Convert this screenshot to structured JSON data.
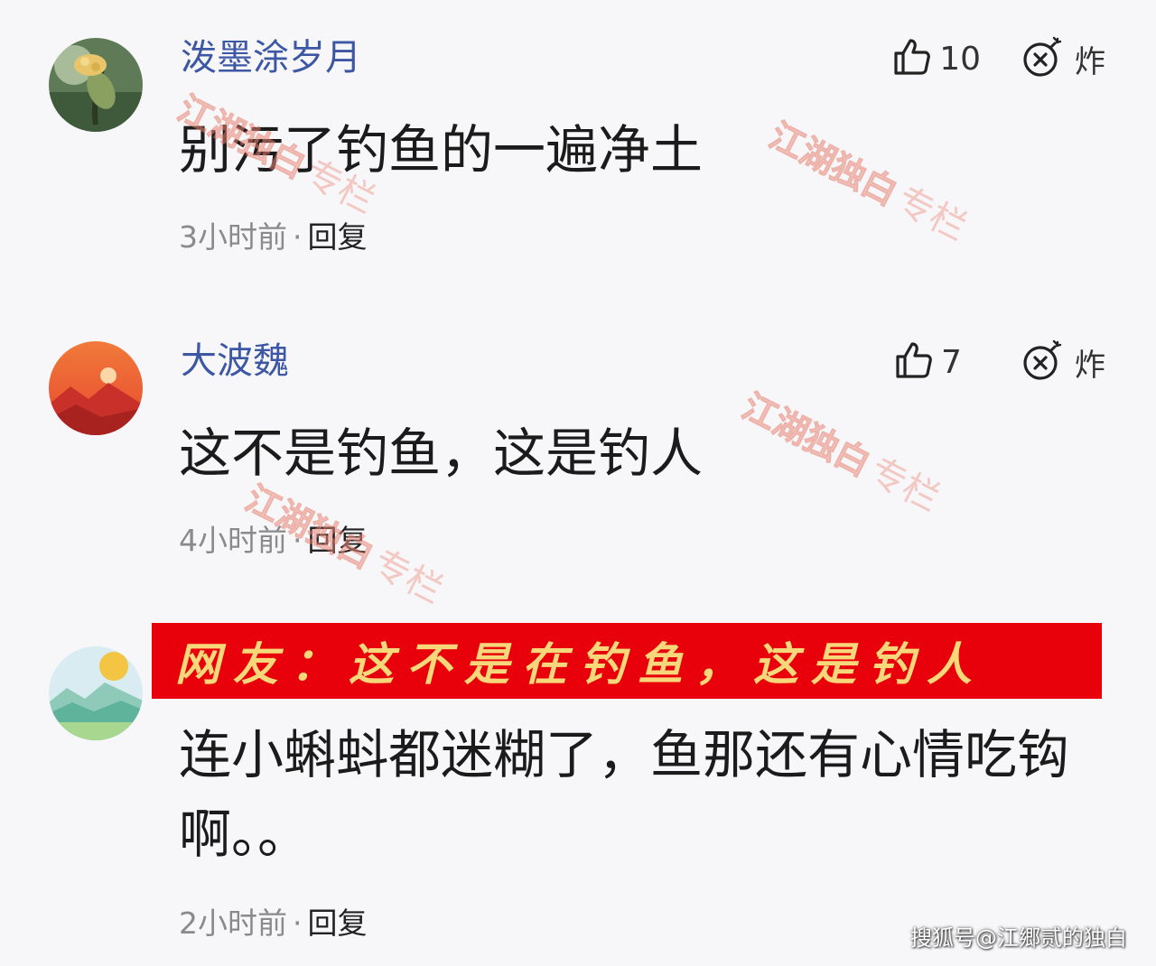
{
  "comments": [
    {
      "username": "泼墨涂岁月",
      "likes": "10",
      "bomb_label": "炸",
      "text": "别污了钓鱼的一遍净土",
      "time": "3小时前",
      "separator": "·",
      "reply": "回复"
    },
    {
      "username": "大波魏",
      "likes": "7",
      "bomb_label": "炸",
      "text": "这不是钓鱼，这是钓人",
      "time": "4小时前",
      "separator": "·",
      "reply": "回复"
    },
    {
      "username": "",
      "text": "连小蝌蚪都迷糊了，鱼那还有心情吃钩啊。。",
      "time": "2小时前",
      "separator": "·",
      "reply": "回复"
    }
  ],
  "banner": {
    "text": "网友：这不是在钓鱼，这是钓人",
    "background": "#e8000b",
    "text_color": "#f6d87a"
  },
  "watermark": {
    "brand": "江湖独白",
    "suffix": "专栏"
  },
  "footer": {
    "credit": "搜狐号@江郷贰的独白"
  },
  "colors": {
    "username": "#3d57a5",
    "content": "#1b1b1b",
    "meta": "#8a8a8a"
  }
}
